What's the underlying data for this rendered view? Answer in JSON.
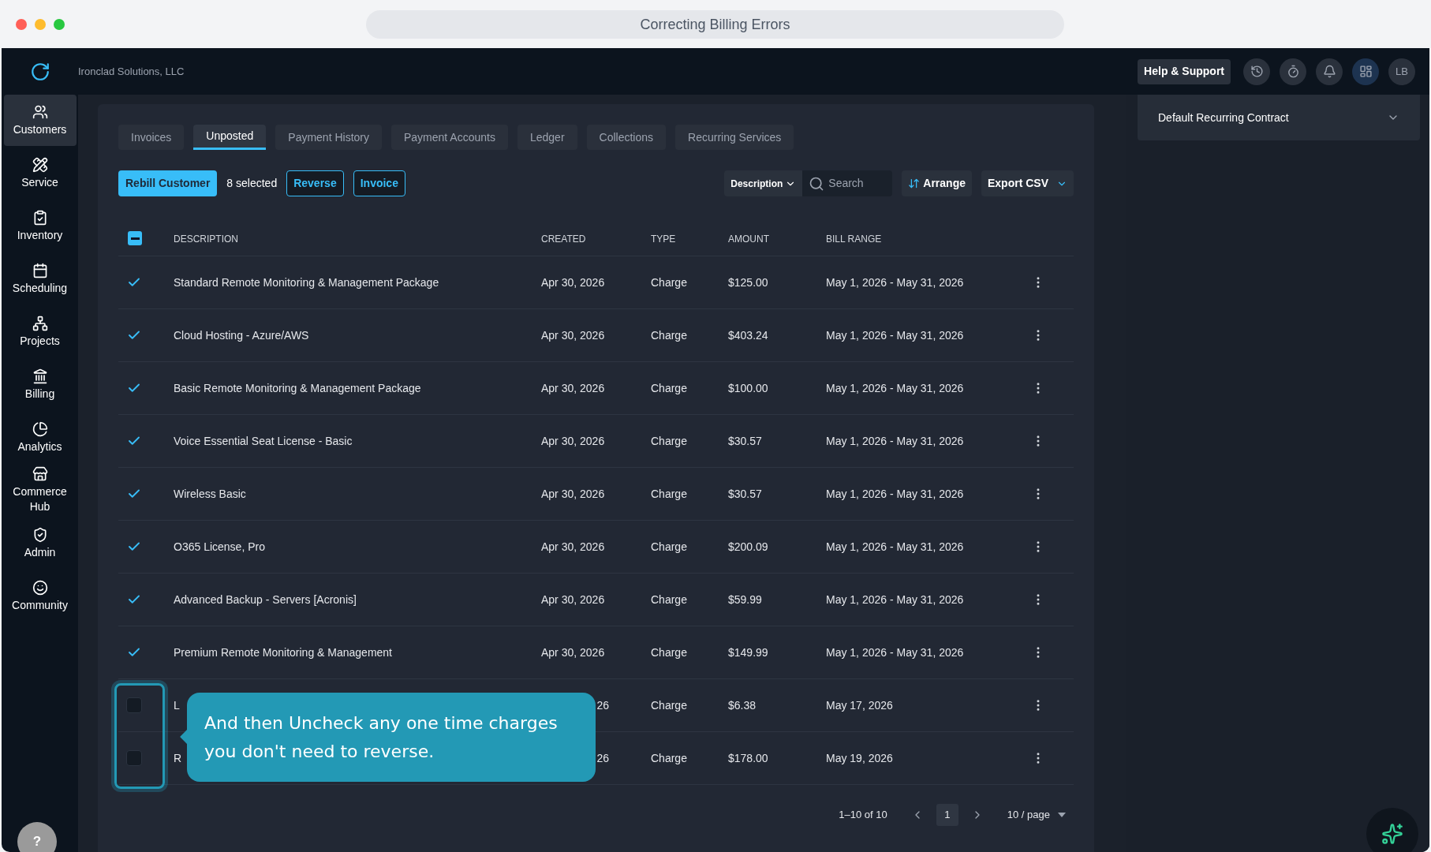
{
  "window": {
    "title": "Correcting Billing Errors"
  },
  "header": {
    "company": "Ironclad Solutions, LLC",
    "help_button": "Help & Support",
    "avatar": "LB"
  },
  "sidebar": {
    "items": [
      {
        "label": "Customers",
        "selected": true
      },
      {
        "label": "Service",
        "selected": false
      },
      {
        "label": "Inventory",
        "selected": false
      },
      {
        "label": "Scheduling",
        "selected": false
      },
      {
        "label": "Projects",
        "selected": false
      },
      {
        "label": "Billing",
        "selected": false
      },
      {
        "label": "Analytics",
        "selected": false
      },
      {
        "label": "Commerce Hub",
        "selected": false
      },
      {
        "label": "Admin",
        "selected": false
      },
      {
        "label": "Community",
        "selected": false
      }
    ],
    "help": "?"
  },
  "tabs": [
    {
      "label": "Invoices",
      "selected": false
    },
    {
      "label": "Unposted",
      "selected": true
    },
    {
      "label": "Payment History",
      "selected": false
    },
    {
      "label": "Payment Accounts",
      "selected": false
    },
    {
      "label": "Ledger",
      "selected": false
    },
    {
      "label": "Collections",
      "selected": false
    },
    {
      "label": "Recurring Services",
      "selected": false
    }
  ],
  "toolbar": {
    "primary_button": "Rebill Customer",
    "selected_count": "8 selected",
    "buttons": [
      "Reverse",
      "Invoice"
    ],
    "filter": "Description",
    "search": {
      "placeholder": "Search"
    },
    "arrange": "Arrange",
    "export": "Export CSV"
  },
  "table": {
    "select_all": {
      "indeterminate": true
    },
    "columns": [
      "DESCRIPTION",
      "CREATED",
      "TYPE",
      "AMOUNT",
      "BILL RANGE"
    ],
    "rows": [
      {
        "checked": true,
        "covered": false,
        "description": "Standard Remote Monitoring & Management Package",
        "created": "Apr 30, 2026",
        "type": "Charge",
        "amount": "$125.00",
        "bill_range": "May 1, 2026 - May 31, 2026"
      },
      {
        "checked": true,
        "covered": false,
        "description": "Cloud Hosting - Azure/AWS",
        "created": "Apr 30, 2026",
        "type": "Charge",
        "amount": "$403.24",
        "bill_range": "May 1, 2026 - May 31, 2026"
      },
      {
        "checked": true,
        "covered": false,
        "description": "Basic Remote Monitoring & Management Package",
        "created": "Apr 30, 2026",
        "type": "Charge",
        "amount": "$100.00",
        "bill_range": "May 1, 2026 - May 31, 2026"
      },
      {
        "checked": true,
        "covered": false,
        "description": "Voice Essential Seat License - Basic",
        "created": "Apr 30, 2026",
        "type": "Charge",
        "amount": "$30.57",
        "bill_range": "May 1, 2026 - May 31, 2026"
      },
      {
        "checked": true,
        "covered": false,
        "description": "Wireless Basic",
        "created": "Apr 30, 2026",
        "type": "Charge",
        "amount": "$30.57",
        "bill_range": "May 1, 2026 - May 31, 2026"
      },
      {
        "checked": true,
        "covered": false,
        "description": "O365 License, Pro",
        "created": "Apr 30, 2026",
        "type": "Charge",
        "amount": "$200.09",
        "bill_range": "May 1, 2026 - May 31, 2026"
      },
      {
        "checked": true,
        "covered": false,
        "description": "Advanced Backup - Servers [Acronis]",
        "created": "Apr 30, 2026",
        "type": "Charge",
        "amount": "$59.99",
        "bill_range": "May 1, 2026 - May 31, 2026"
      },
      {
        "checked": true,
        "covered": false,
        "description": "Premium Remote Monitoring & Management",
        "created": "Apr 30, 2026",
        "type": "Charge",
        "amount": "$149.99",
        "bill_range": "May 1, 2026 - May 31, 2026"
      },
      {
        "checked": false,
        "covered": true,
        "description": "L",
        "created": "26",
        "type": "Charge",
        "amount": "$6.38",
        "bill_range": "May 17, 2026"
      },
      {
        "checked": false,
        "covered": true,
        "description": "R",
        "created": "26",
        "type": "Charge",
        "amount": "$178.00",
        "bill_range": "May 19, 2026"
      }
    ]
  },
  "pagination": {
    "range": "1–10 of 10",
    "page": "1",
    "page_size": "10 / page"
  },
  "right_panel": {
    "dropdown": "Default Recurring Contract"
  },
  "tooltip": {
    "text": "And then Uncheck any one time charges you don't need to reverse."
  }
}
